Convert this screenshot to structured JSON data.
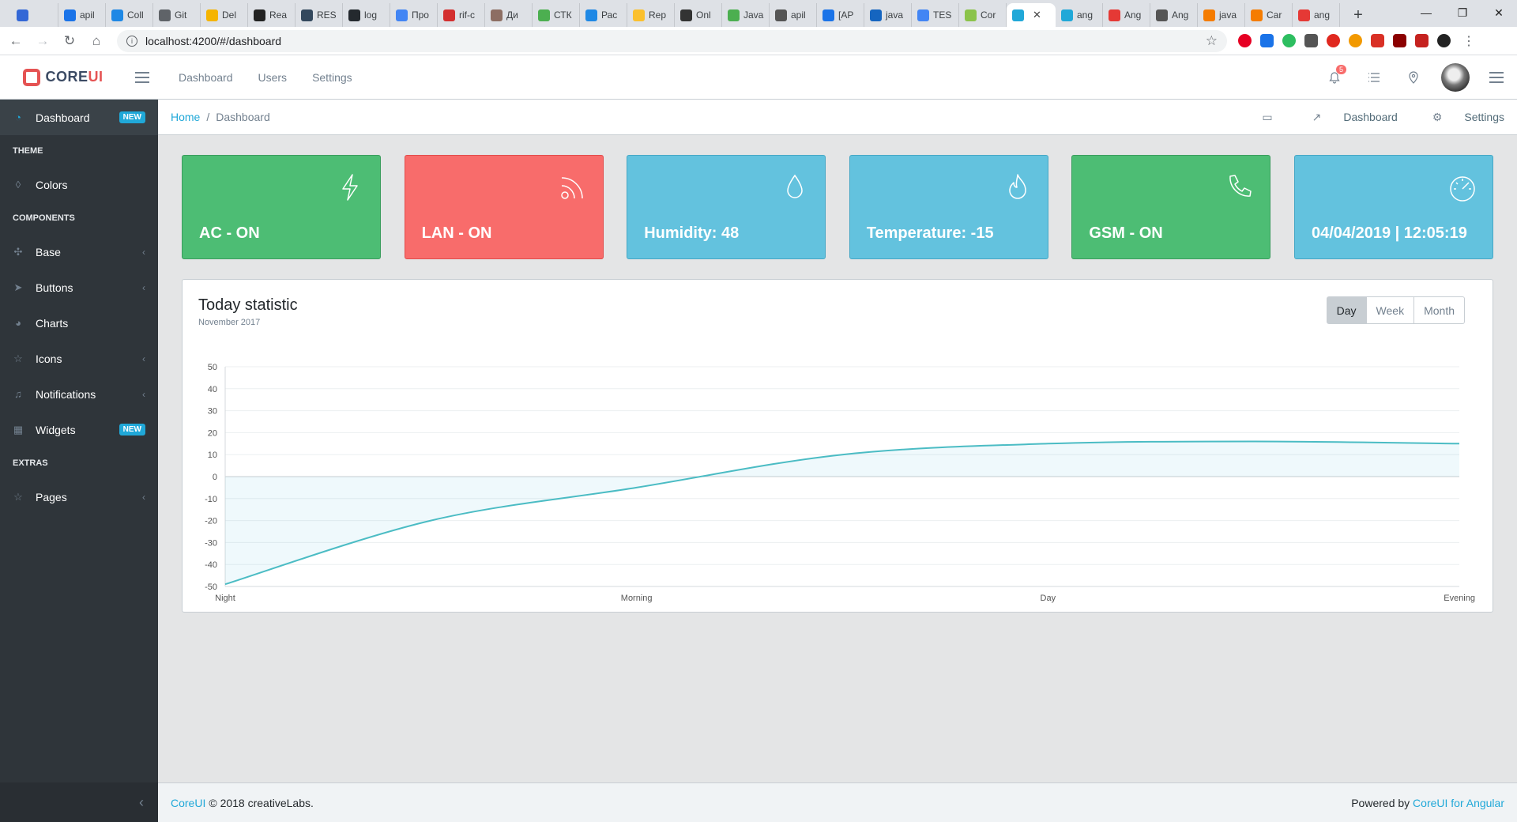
{
  "browser": {
    "tabs": [
      "",
      "apil",
      "Coll",
      "Git",
      "Del",
      "Rea",
      "RES",
      "log",
      "Про",
      "rif-c",
      "Ди",
      "СТК",
      "Рас",
      "Rep",
      "Onl",
      "Java",
      "apil",
      "[AP",
      "java",
      "TES",
      "Cor",
      "",
      "ang",
      "Ang",
      "Ang",
      "java",
      "Car",
      "ang"
    ],
    "active_tab_index": 21,
    "url": "localhost:4200/#/dashboard"
  },
  "header": {
    "brand_core": "CORE",
    "brand_ui": "UI",
    "nav": [
      "Dashboard",
      "Users",
      "Settings"
    ],
    "notification_count": "5"
  },
  "sidebar": {
    "dashboard": {
      "label": "Dashboard",
      "badge": "NEW"
    },
    "theme_title": "THEME",
    "colors": "Colors",
    "components_title": "COMPONENTS",
    "base": "Base",
    "buttons": "Buttons",
    "charts": "Charts",
    "icons": "Icons",
    "notifications": "Notifications",
    "widgets": {
      "label": "Widgets",
      "badge": "NEW"
    },
    "extras_title": "EXTRAS",
    "pages": "Pages"
  },
  "breadcrumb": {
    "home": "Home",
    "separator": "/",
    "current": "Dashboard",
    "menu_dashboard": "Dashboard",
    "menu_settings": "Settings"
  },
  "widgets": [
    {
      "value": "AC - ON",
      "icon": "bolt-icon",
      "color": "#4dbd74"
    },
    {
      "value": "LAN - ON",
      "icon": "rss-icon",
      "color": "#f86c6b"
    },
    {
      "value": "Humidity: 48",
      "icon": "drop-icon",
      "color": "#63c2de"
    },
    {
      "value": "Temperature: -15",
      "icon": "fire-icon",
      "color": "#63c2de"
    },
    {
      "value": "GSM - ON",
      "icon": "phone-icon",
      "color": "#4dbd74"
    },
    {
      "value": "04/04/2019 | 12:05:19",
      "icon": "speedometer-icon",
      "color": "#63c2de"
    }
  ],
  "statistic": {
    "title": "Today statistic",
    "subtitle": "November 2017",
    "periods": [
      "Day",
      "Week",
      "Month"
    ],
    "selected_period": "Day"
  },
  "chart_data": {
    "type": "area",
    "title": "Today statistic",
    "subtitle": "November 2017",
    "x": [
      0,
      1,
      2,
      3,
      4,
      5,
      6
    ],
    "x_tick_labels": [
      "Night",
      "Morning",
      "Day",
      "Evening"
    ],
    "x_tick_positions": [
      0,
      2,
      4,
      6
    ],
    "series": [
      {
        "values": [
          -49,
          -20,
          -5,
          10,
          15,
          16,
          15
        ],
        "color": "#4bbcc4"
      }
    ],
    "ylim": [
      -50,
      50
    ],
    "yticks": [
      50,
      40,
      30,
      20,
      10,
      0,
      -10,
      -20,
      -30,
      -40,
      -50
    ],
    "grid": true,
    "fill_color": "rgba(99,194,222,0.10)"
  },
  "footer": {
    "brand_link": "CoreUI",
    "copyright": "© 2018 creativeLabs.",
    "powered_by": "Powered by",
    "powered_link": "CoreUI for Angular"
  }
}
